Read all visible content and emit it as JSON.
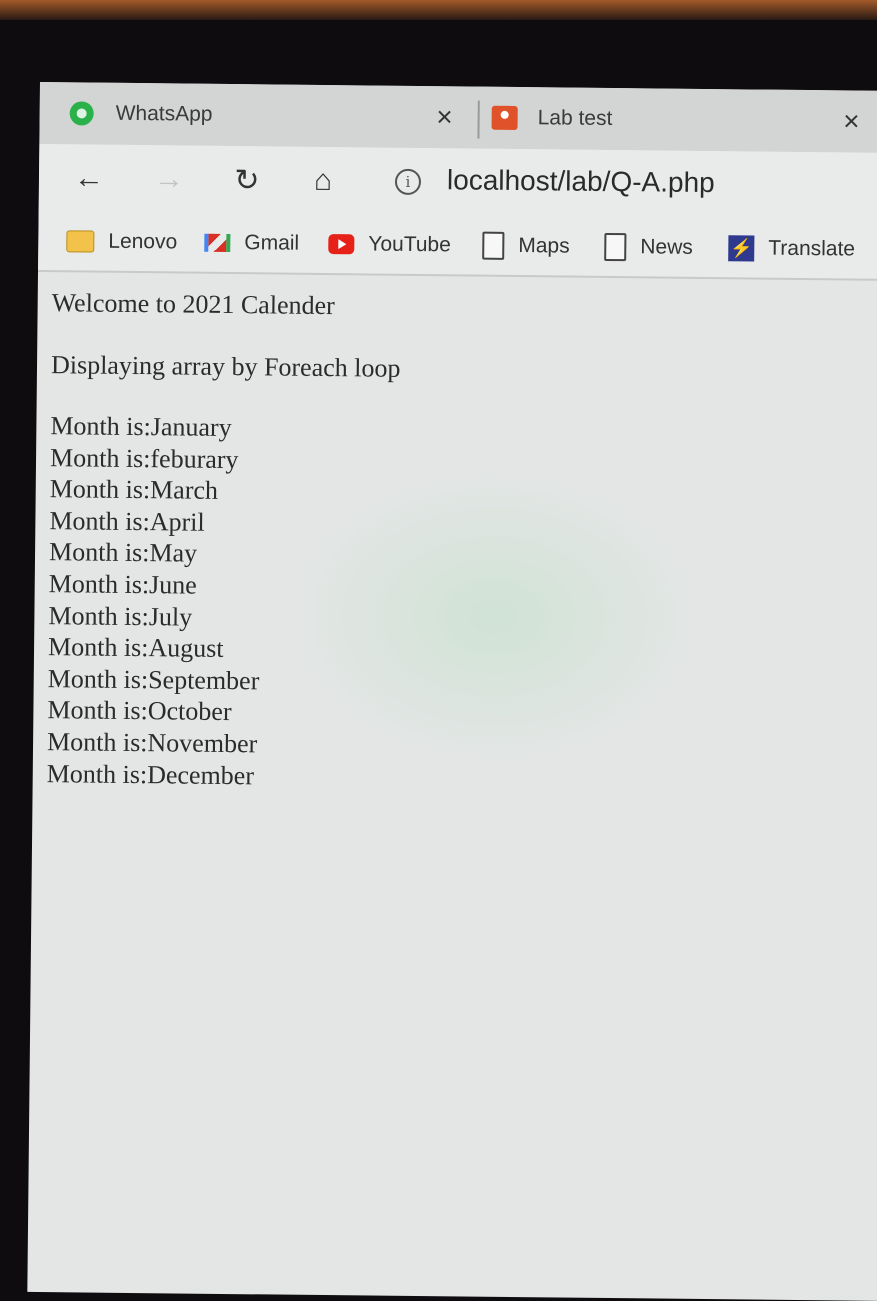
{
  "tabs": [
    {
      "label": "WhatsApp",
      "icon": "whatsapp-icon",
      "close": "×"
    },
    {
      "label": "Lab test",
      "icon": "lab-test-favicon",
      "close": "×"
    }
  ],
  "toolbar": {
    "back": "←",
    "forward": "→",
    "reload": "↻",
    "home": "⌂",
    "info": "i",
    "url": "localhost/lab/Q-A.php"
  },
  "bookmarks": [
    {
      "label": "Lenovo",
      "icon": "folder-icon"
    },
    {
      "label": "Gmail",
      "icon": "gmail-icon"
    },
    {
      "label": "YouTube",
      "icon": "youtube-icon"
    },
    {
      "label": "Maps",
      "icon": "page-icon"
    },
    {
      "label": "News",
      "icon": "page-icon"
    },
    {
      "label": "Translate",
      "icon": "translate-icon",
      "glyph": "⚡"
    }
  ],
  "page": {
    "heading": "Welcome to 2021 Calender",
    "subheading": "Displaying array by Foreach loop",
    "months": [
      "Month is:January",
      "Month is:feburary",
      "Month is:March",
      "Month is:April",
      "Month is:May",
      "Month is:June",
      "Month is:July",
      "Month is:August",
      "Month is:September",
      "Month is:October",
      "Month is:November",
      "Month is:December"
    ]
  }
}
